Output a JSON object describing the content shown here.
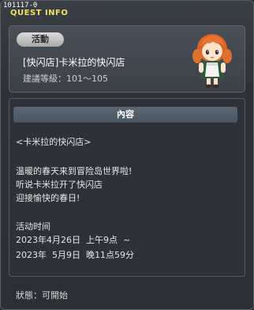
{
  "window": {
    "id_code": "101117-0",
    "title": "QUEST INFO"
  },
  "header": {
    "badge": "活動",
    "quest_name": "[快闪店]卡米拉的快闪店",
    "recommend_level": "建議等級：101～105",
    "npc_icon": "npc-girl-portrait-icon"
  },
  "content": {
    "section_title": "內容",
    "lines": [
      "<卡米拉的快闪店>",
      "温暖的春天来到冒险岛世界啦!",
      "听说卡米拉开了快闪店",
      "迎接愉快的春日!",
      "活动时间",
      "2023年4月26日  上午9点  ~",
      "2023年  5月9日  晚11点59分"
    ]
  },
  "status": {
    "text": "狀態：可開始"
  },
  "colors": {
    "title_yellow": "#f0e060",
    "panel_bg": "#3c4047",
    "content_header": "#4f5a68"
  }
}
